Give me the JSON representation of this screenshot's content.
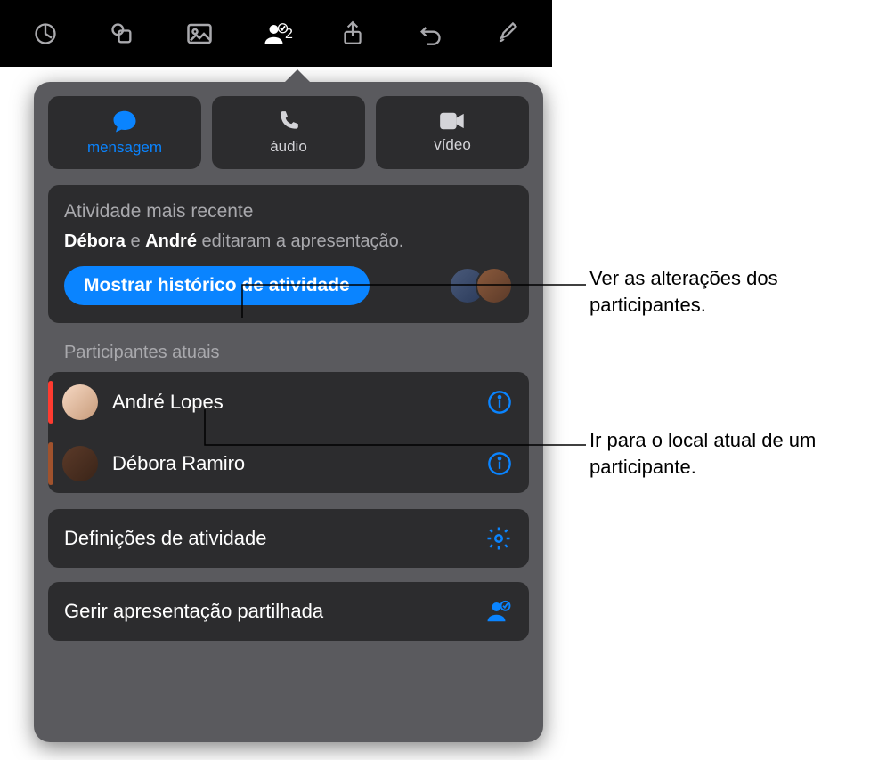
{
  "toolbar": {
    "collab_count": "2"
  },
  "comm": {
    "message": "mensagem",
    "audio": "áudio",
    "video": "vídeo"
  },
  "activity": {
    "title": "Atividade mais recente",
    "person1": "Débora",
    "connector": " e ",
    "person2": "André",
    "action_suffix": " editaram a apresentação.",
    "show_history": "Mostrar histórico de atividade"
  },
  "participants": {
    "section_label": "Participantes atuais",
    "items": [
      {
        "name": "André Lopes"
      },
      {
        "name": "Débora Ramiro"
      }
    ]
  },
  "actions": {
    "activity_settings": "Definições de atividade",
    "manage_shared": "Gerir apresentação partilhada"
  },
  "callouts": {
    "c1": "Ver as alterações dos participantes.",
    "c2": "Ir para o local atual de um participante."
  }
}
